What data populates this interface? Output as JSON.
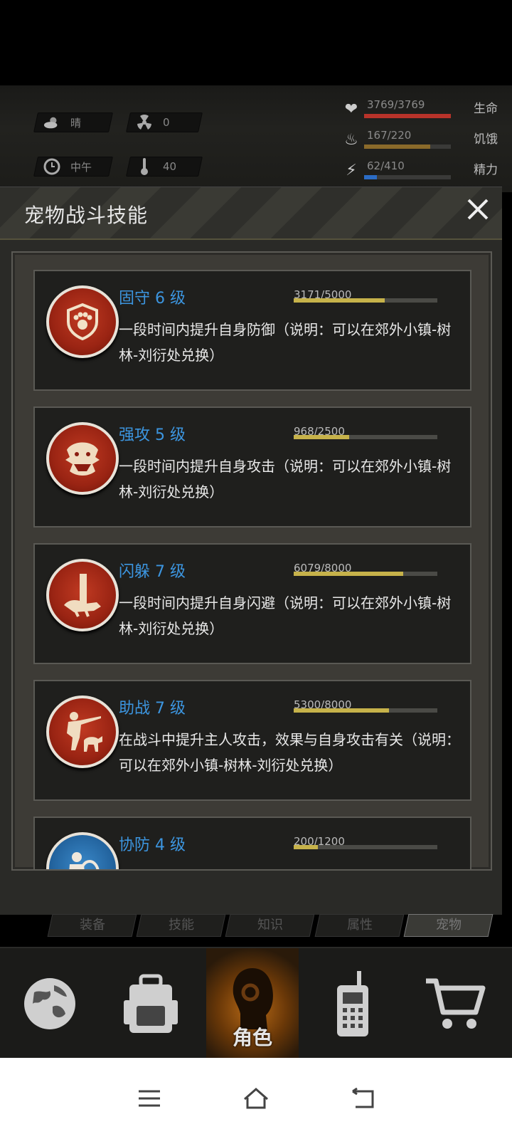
{
  "status": {
    "weather": {
      "icon": "cloud-sun-icon",
      "label": "晴"
    },
    "radiation": {
      "icon": "radiation-icon",
      "value": "0"
    },
    "time": {
      "icon": "clock-icon",
      "label": "中午"
    },
    "temperature": {
      "icon": "thermometer-icon",
      "value": "40"
    },
    "bars": [
      {
        "name": "health",
        "icon": "heart-icon",
        "value": "3769/3769",
        "label": "生命",
        "fraction": 1.0,
        "color": "#b8332a"
      },
      {
        "name": "hunger",
        "icon": "stomach-icon",
        "value": "167/220",
        "label": "饥饿",
        "fraction": 0.76,
        "color": "#8a6a2a"
      },
      {
        "name": "energy",
        "icon": "lightning-icon",
        "value": "62/410",
        "label": "精力",
        "fraction": 0.15,
        "color": "#2b6cc4"
      }
    ]
  },
  "panel": {
    "title": "宠物战斗技能",
    "close_icon": "close-icon"
  },
  "skills": [
    {
      "name": "固守 6 级",
      "progress": "3171/5000",
      "fraction": 0.634,
      "desc": "一段时间内提升自身防御（说明：可以在郊外小镇-树林-刘衍处兑换）",
      "icon": "paw-shield-icon"
    },
    {
      "name": "强攻 5 级",
      "progress": "968/2500",
      "fraction": 0.387,
      "desc": "一段时间内提升自身攻击（说明：可以在郊外小镇-树林-刘衍处兑换）",
      "icon": "beast-head-icon"
    },
    {
      "name": "闪躲 7 级",
      "progress": "6079/8000",
      "fraction": 0.76,
      "desc": "一段时间内提升自身闪避（说明：可以在郊外小镇-树林-刘衍处兑换）",
      "icon": "dodging-dog-icon"
    },
    {
      "name": "助战 7 级",
      "progress": "5300/8000",
      "fraction": 0.6625,
      "desc": "在战斗中提升主人攻击，效果与自身攻击有关（说明：可以在郊外小镇-树林-刘衍处兑换）",
      "icon": "hunter-dog-icon"
    },
    {
      "name": "协防 4 级",
      "progress": "200/1200",
      "fraction": 0.167,
      "desc": "",
      "icon": "shield-guard-icon"
    }
  ],
  "tabs": [
    "装备",
    "技能",
    "知识",
    "属性",
    "宠物"
  ],
  "active_tab": "宠物",
  "nav": [
    {
      "icon": "globe-icon",
      "label": ""
    },
    {
      "icon": "backpack-icon",
      "label": ""
    },
    {
      "icon": "character-head-icon",
      "label": "角色"
    },
    {
      "icon": "radio-icon",
      "label": ""
    },
    {
      "icon": "cart-icon",
      "label": ""
    }
  ],
  "system_nav": [
    "menu-icon",
    "home-icon",
    "back-icon"
  ]
}
